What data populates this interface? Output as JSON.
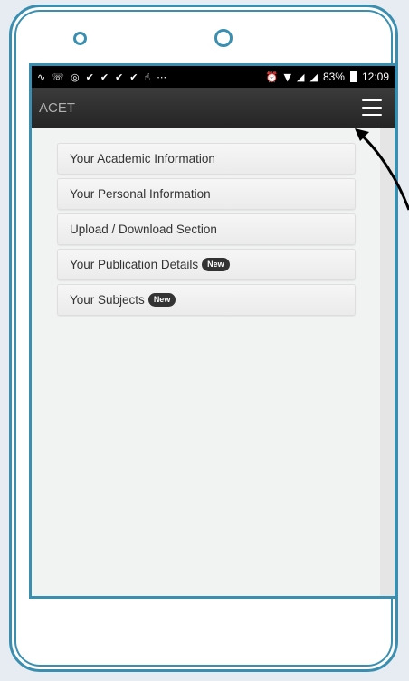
{
  "status_bar": {
    "icons": [
      "signal-icon",
      "phone-icon",
      "whatsapp-icon",
      "check-icon",
      "check-icon",
      "check-icon",
      "check-icon",
      "hand-icon",
      "ellipsis-icon",
      "alarm-icon",
      "wifi-icon",
      "signal-bars-icon",
      "signal-bars-icon"
    ],
    "battery": "83%",
    "time": "12:09"
  },
  "navbar": {
    "brand": "ACET",
    "menu_icon": "hamburger-icon"
  },
  "menu": {
    "items": [
      {
        "label": "Your Academic Information",
        "badge": ""
      },
      {
        "label": "Your Personal Information",
        "badge": ""
      },
      {
        "label": "Upload / Download Section",
        "badge": ""
      },
      {
        "label": "Your Publication Details",
        "badge": "New"
      },
      {
        "label": "Your Subjects",
        "badge": "New"
      }
    ]
  },
  "colors": {
    "frame": "#3a8fb0",
    "navbar": "#2b2b2b",
    "badge": "#333333"
  }
}
